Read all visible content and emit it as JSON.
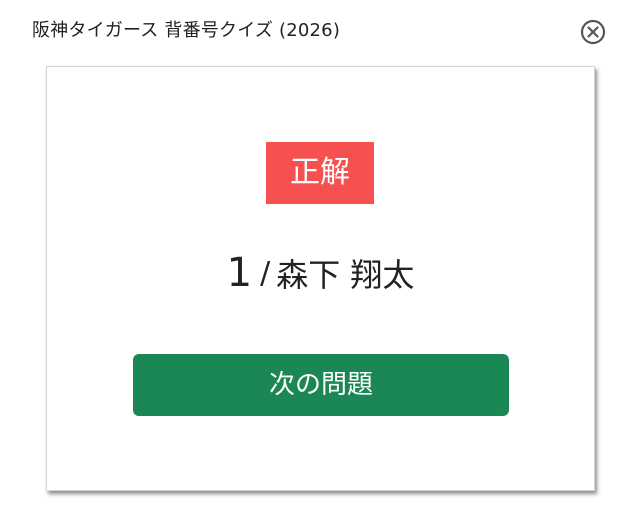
{
  "window": {
    "title": "阪神タイガース 背番号クイズ (2026)"
  },
  "result": {
    "label": "正解"
  },
  "answer": {
    "number": "1",
    "separator": "/",
    "player_name": "森下 翔太"
  },
  "actions": {
    "next_label": "次の問題"
  },
  "colors": {
    "correct_badge": "#f75050",
    "next_button": "#1a8754",
    "close_icon": "#555555"
  },
  "icons": {
    "close": "close-circle-x-icon"
  }
}
